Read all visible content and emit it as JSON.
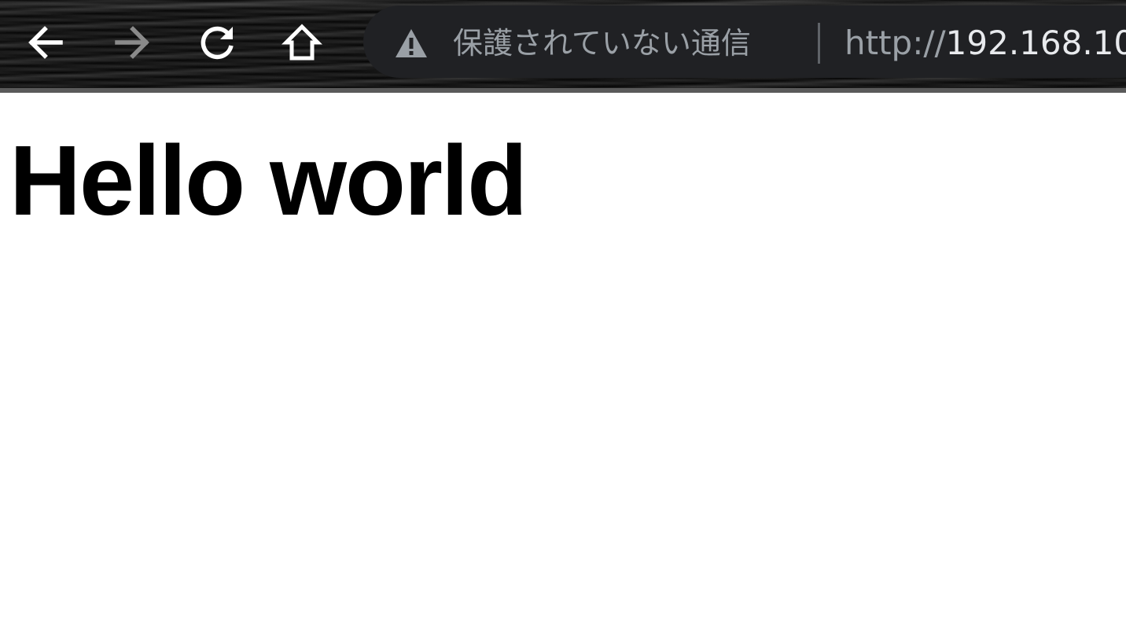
{
  "toolbar": {
    "back": {
      "icon": "arrow-left-icon",
      "enabled": true
    },
    "forward": {
      "icon": "arrow-right-icon",
      "enabled": false
    },
    "reload": {
      "icon": "reload-icon"
    },
    "home": {
      "icon": "home-icon"
    }
  },
  "omnibox": {
    "security_icon": "warning-triangle-icon",
    "security_label": "保護されていない通信",
    "url_scheme": "http://",
    "url_host": "192.168.10"
  },
  "page": {
    "heading": "Hello world"
  },
  "colors": {
    "toolbar_bg": "#0a0a0a",
    "omnibox_bg": "#202124",
    "icon_enabled": "#ffffff",
    "icon_disabled": "#8a8a8a",
    "muted_text": "#9aa0a6",
    "url_text": "#e8eaed"
  }
}
